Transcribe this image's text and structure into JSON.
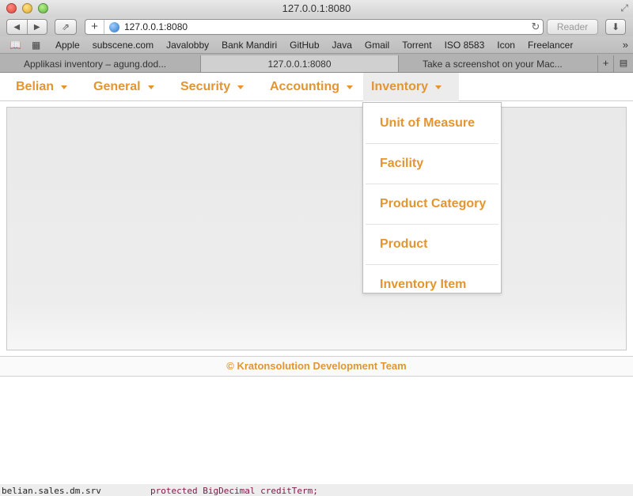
{
  "window": {
    "title": "127.0.0.1:8080"
  },
  "toolbar": {
    "back_icon": "back-arrow-icon",
    "forward_icon": "forward-arrow-icon",
    "back_glyph": "◀",
    "forward_glyph": "▶",
    "share_glyph": "⇗",
    "add_glyph": "+",
    "reload_glyph": "↻",
    "download_glyph": "⬇",
    "url": "127.0.0.1:8080",
    "reader_label": "Reader"
  },
  "bookmarks": {
    "book_glyph": "📖",
    "grid_glyph": "▦",
    "items": [
      "Apple",
      "subscene.com",
      "Javalobby",
      "Bank Mandiri",
      "GitHub",
      "Java",
      "Gmail",
      "Torrent",
      "ISO 8583",
      "Icon",
      "Freelancer"
    ],
    "more_glyph": "»"
  },
  "tabs": [
    {
      "label": "Applikasi inventory – agung.dod..."
    },
    {
      "label": "127.0.0.1:8080"
    },
    {
      "label": "Take a screenshot on your Mac..."
    }
  ],
  "tab_controls": {
    "new_tab_glyph": "+",
    "overview_glyph": "▤"
  },
  "menu": {
    "items": [
      {
        "label": "Belian"
      },
      {
        "label": "General"
      },
      {
        "label": "Security"
      },
      {
        "label": "Accounting"
      },
      {
        "label": "Inventory"
      }
    ],
    "open_menu": "Inventory",
    "accent_color": "#e39530"
  },
  "dropdown": {
    "items": [
      {
        "label": "Unit of Measure"
      },
      {
        "label": "Facility"
      },
      {
        "label": "Product Category"
      },
      {
        "label": "Product"
      },
      {
        "label": "Inventory Item"
      }
    ]
  },
  "footer": {
    "text": "© Kratonsolution Development Team"
  },
  "background_window": {
    "file_label": "belian.sales.dm.srv",
    "code_text": "protected BigDecimal creditTerm;"
  }
}
